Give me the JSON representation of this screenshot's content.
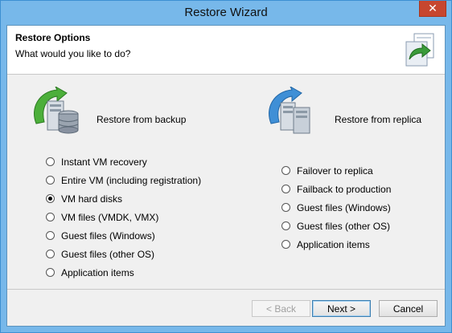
{
  "window": {
    "title": "Restore Wizard",
    "close_label": "✕"
  },
  "header": {
    "title": "Restore Options",
    "subtitle": "What would you like to do?",
    "icon": "restore-arrow-icon"
  },
  "backup": {
    "title": "Restore from backup",
    "icon": "backup-server-database-icon",
    "options": [
      {
        "label": "Instant VM recovery",
        "checked": false
      },
      {
        "label": "Entire VM (including registration)",
        "checked": false
      },
      {
        "label": "VM hard disks",
        "checked": true
      },
      {
        "label": "VM files (VMDK, VMX)",
        "checked": false
      },
      {
        "label": "Guest files (Windows)",
        "checked": false
      },
      {
        "label": "Guest files (other OS)",
        "checked": false
      },
      {
        "label": "Application items",
        "checked": false
      }
    ]
  },
  "replica": {
    "title": "Restore from replica",
    "icon": "replica-server-icon",
    "options": [
      {
        "label": "Failover to replica",
        "checked": false
      },
      {
        "label": "Failback to production",
        "checked": false
      },
      {
        "label": "Guest files (Windows)",
        "checked": false
      },
      {
        "label": "Guest files (other OS)",
        "checked": false
      },
      {
        "label": "Application items",
        "checked": false
      }
    ]
  },
  "buttons": {
    "back": "< Back",
    "next": "Next >",
    "cancel": "Cancel"
  },
  "colors": {
    "title_bar": "#77b8ea",
    "close_button": "#c7462f",
    "dialog_body": "#f0f0f0"
  }
}
